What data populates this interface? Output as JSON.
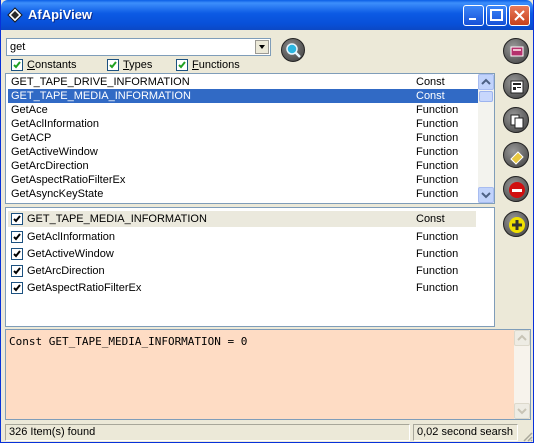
{
  "window": {
    "title": "AfApiView"
  },
  "search": {
    "query": "get"
  },
  "filters": [
    {
      "label_prefix": "",
      "label_underline": "C",
      "label_rest": "onstants",
      "checked": true
    },
    {
      "label_prefix": "",
      "label_underline": "T",
      "label_rest": "ypes",
      "checked": true
    },
    {
      "label_prefix": "",
      "label_underline": "F",
      "label_rest": "unctions",
      "checked": true
    }
  ],
  "results": [
    {
      "name": "GET_TAPE_DRIVE_INFORMATION",
      "type": "Const"
    },
    {
      "name": "GET_TAPE_MEDIA_INFORMATION",
      "type": "Const",
      "selected": true
    },
    {
      "name": "GetAce",
      "type": "Function"
    },
    {
      "name": "GetAclInformation",
      "type": "Function"
    },
    {
      "name": "GetACP",
      "type": "Function"
    },
    {
      "name": "GetActiveWindow",
      "type": "Function"
    },
    {
      "name": "GetArcDirection",
      "type": "Function"
    },
    {
      "name": "GetAspectRatioFilterEx",
      "type": "Function"
    },
    {
      "name": "GetAsyncKeyState",
      "type": "Function"
    }
  ],
  "chosen": [
    {
      "name": "GET_TAPE_MEDIA_INFORMATION",
      "type": "Const",
      "highlighted": true
    },
    {
      "name": "GetAclInformation",
      "type": "Function"
    },
    {
      "name": "GetActiveWindow",
      "type": "Function"
    },
    {
      "name": "GetArcDirection",
      "type": "Function"
    },
    {
      "name": "GetAspectRatioFilterEx",
      "type": "Function"
    }
  ],
  "output": {
    "text": "Const GET_TAPE_MEDIA_INFORMATION = 0"
  },
  "side_buttons": [
    {
      "icon": "book-icon"
    },
    {
      "icon": "properties-icon"
    },
    {
      "icon": "copy-icon"
    },
    {
      "icon": "eraser-icon"
    },
    {
      "icon": "minus-icon"
    },
    {
      "icon": "plus-icon"
    }
  ],
  "status": {
    "count": "326 Item(s) found",
    "time": "0,02 second searsh"
  },
  "colors": {
    "selection": "#316ac5",
    "output_bg": "#fedcc4",
    "minus": "#d01010",
    "plus": "#f0e000"
  }
}
